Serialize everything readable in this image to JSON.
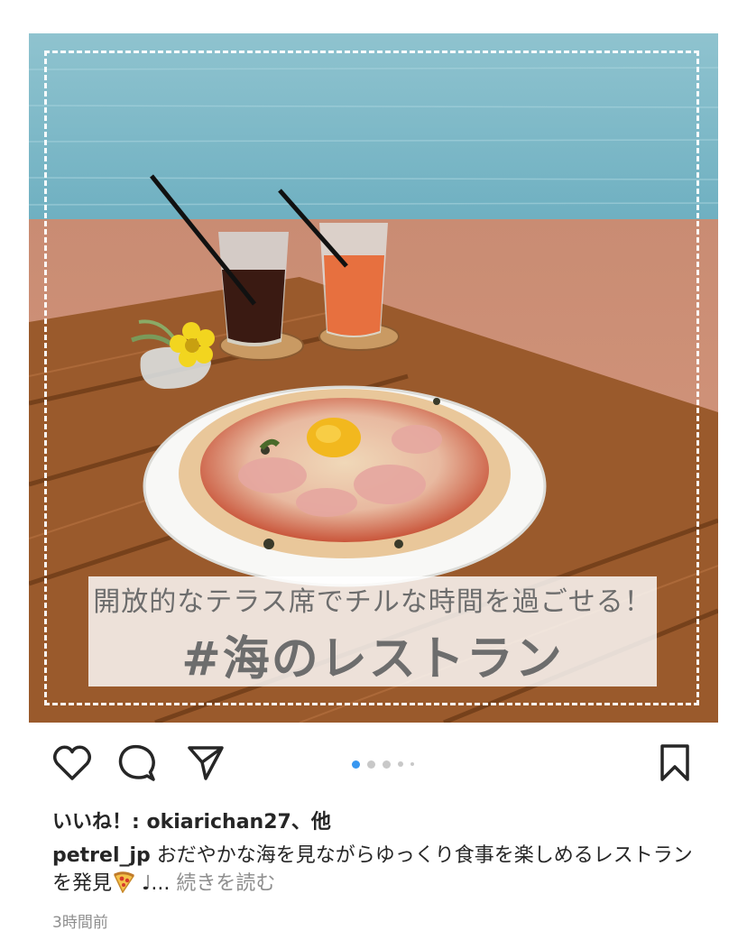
{
  "post": {
    "image_caption_sub": "開放的なテラス席でチルな時間を過ごせる！",
    "image_caption_main": "#海のレストラン",
    "carousel": {
      "count": 5,
      "active_index": 0
    }
  },
  "actions": {
    "like_icon": "heart-icon",
    "comment_icon": "comment-bubble-icon",
    "share_icon": "paper-plane-icon",
    "bookmark_icon": "bookmark-icon"
  },
  "likes": {
    "prefix": "いいね！: ",
    "liker": "okiarichan27",
    "suffix": "、他"
  },
  "caption": {
    "username": "petrel_jp",
    "text": " おだやかな海を見ながらゆっくり食事を楽しめるレストランを発見",
    "emoji": "pizza-icon",
    "after_emoji": " ♩... ",
    "more": "続きを読む"
  },
  "timestamp": "3時間前",
  "colors": {
    "accent_dot": "#3897f0",
    "text_primary": "#262626",
    "text_secondary": "#8e8e8e"
  }
}
